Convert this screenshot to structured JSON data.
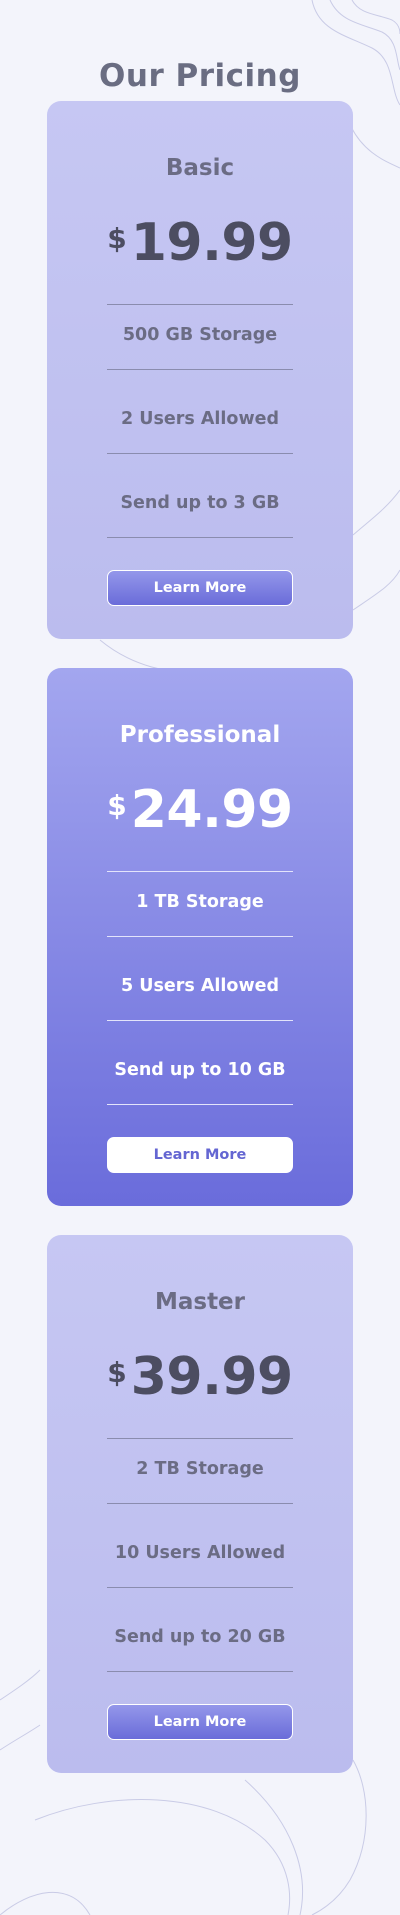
{
  "page": {
    "title": "Our Pricing"
  },
  "plans": [
    {
      "name": "Basic",
      "currency": "$",
      "price": "19.99",
      "features": [
        "500 GB Storage",
        "2 Users Allowed",
        "Send up to 3 GB"
      ],
      "button_label": "Learn More"
    },
    {
      "name": "Professional",
      "currency": "$",
      "price": "24.99",
      "features": [
        "1 TB Storage",
        "5 Users Allowed",
        "Send up to 10 GB"
      ],
      "button_label": "Learn More"
    },
    {
      "name": "Master",
      "currency": "$",
      "price": "39.99",
      "features": [
        "2 TB Storage",
        "10 Users Allowed",
        "Send up to 20 GB"
      ],
      "button_label": "Learn More"
    }
  ],
  "colors": {
    "background": "#f3f4fb",
    "card_light": "#c6c7f3",
    "card_featured_top": "#a3a6ef",
    "card_featured_bottom": "#6a6cdb",
    "accent": "#6a6cd9",
    "heading_text": "#6a6d82"
  }
}
